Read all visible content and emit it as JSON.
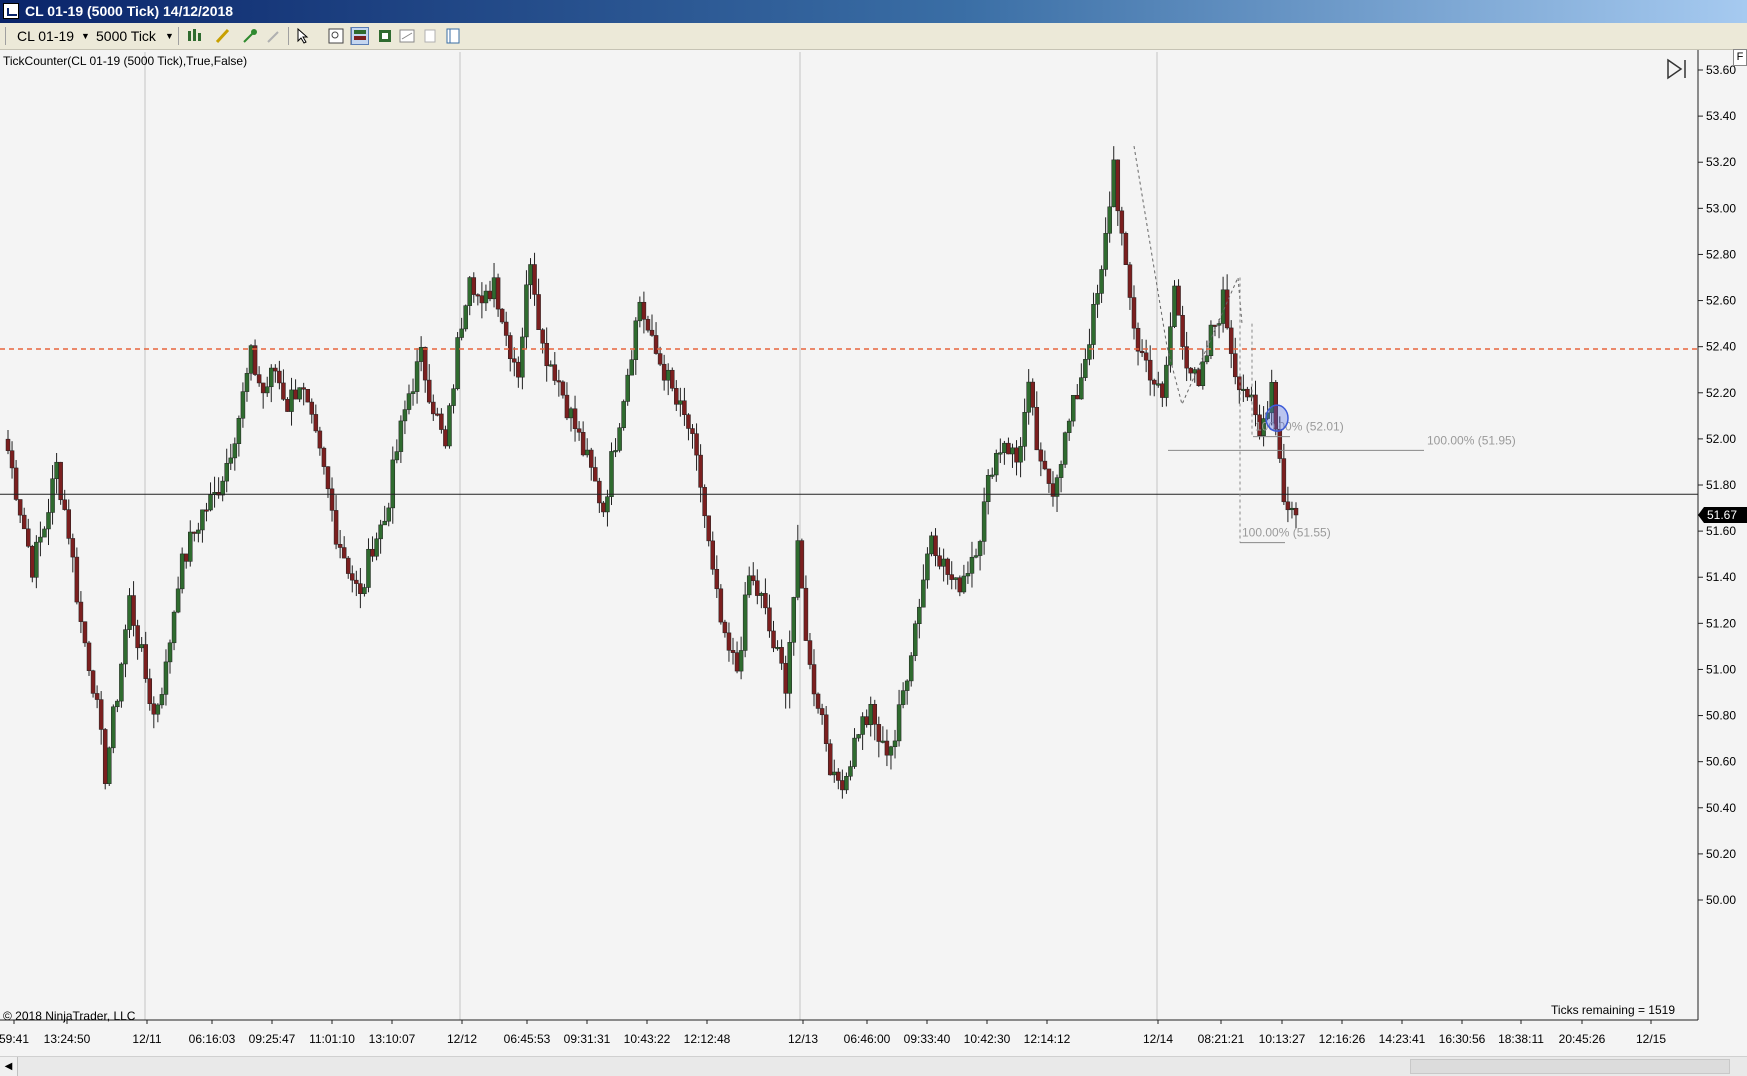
{
  "window": {
    "title": "CL 01-19 (5000 Tick)  14/12/2018"
  },
  "toolbar": {
    "instrument": "CL 01-19",
    "period": "5000 Tick"
  },
  "indicator_label": "TickCounter(CL 01-19 (5000 Tick),True,False)",
  "copyright": "© 2018 NinjaTrader, LLC",
  "ticks_remaining": "Ticks remaining = 1519",
  "corner_button": "F",
  "colors": {
    "up": "#2f6b2f",
    "down": "#7b1f1f",
    "wick": "#202020",
    "ref_line": "#e8643c",
    "price_tag": "#000000",
    "fib": "#9a9a9a"
  },
  "chart_data": {
    "type": "candlestick",
    "title": "",
    "ylim": [
      50.0,
      53.6
    ],
    "y_ticks": [
      "53.60",
      "53.40",
      "53.20",
      "53.00",
      "52.80",
      "52.60",
      "52.40",
      "52.20",
      "52.00",
      "51.80",
      "51.60",
      "51.40",
      "51.20",
      "51.00",
      "50.80",
      "50.60",
      "50.40",
      "50.20",
      "50.00"
    ],
    "x_ticks": [
      "59:41",
      "13:24:50",
      "12/11",
      "06:16:03",
      "09:25:47",
      "11:01:10",
      "13:10:07",
      "12/12",
      "06:45:53",
      "09:31:31",
      "10:43:22",
      "12:12:48",
      "12/13",
      "06:46:00",
      "09:33:40",
      "10:42:30",
      "12:14:12",
      "12/14",
      "08:21:21",
      "10:13:27",
      "12:16:26",
      "14:23:41",
      "16:30:56",
      "18:38:11",
      "20:45:26",
      "12/15"
    ],
    "last_price": 51.67,
    "last_price_label": "51.67",
    "reference_line": 52.39,
    "horizontal_line": 51.76,
    "grid": false,
    "fib_labels": [
      "100.00% (52.01)",
      "100.00% (51.95)",
      "100.00% (51.55)"
    ],
    "fib_levels": [
      52.01,
      51.95,
      51.55
    ],
    "price_path": [
      51.95,
      51.7,
      51.45,
      51.62,
      51.88,
      51.6,
      51.2,
      50.95,
      50.55,
      50.9,
      51.3,
      51.05,
      50.8,
      51.0,
      51.4,
      51.55,
      51.68,
      51.75,
      51.9,
      52.1,
      52.35,
      52.2,
      52.3,
      52.15,
      52.25,
      52.05,
      51.85,
      51.6,
      51.45,
      51.3,
      51.55,
      51.65,
      51.95,
      52.2,
      52.35,
      52.15,
      51.95,
      52.4,
      52.75,
      52.55,
      52.7,
      52.45,
      52.3,
      52.8,
      52.4,
      52.3,
      52.15,
      52.0,
      51.85,
      51.7,
      52.0,
      52.3,
      52.6,
      52.4,
      52.3,
      52.15,
      52.05,
      51.8,
      51.4,
      51.1,
      51.0,
      51.4,
      51.3,
      51.1,
      50.95,
      51.5,
      51.0,
      50.8,
      50.5,
      50.55,
      50.75,
      50.8,
      50.65,
      50.7,
      51.0,
      51.3,
      51.6,
      51.45,
      51.35,
      51.45,
      51.6,
      51.9,
      52.0,
      51.9,
      52.2,
      51.85,
      51.8,
      52.0,
      52.2,
      52.45,
      52.7,
      53.2,
      52.7,
      52.4,
      52.3,
      52.15,
      52.65,
      52.35,
      52.2,
      52.45,
      52.6,
      52.3,
      52.2,
      52.0,
      52.25,
      51.75,
      51.67
    ]
  }
}
